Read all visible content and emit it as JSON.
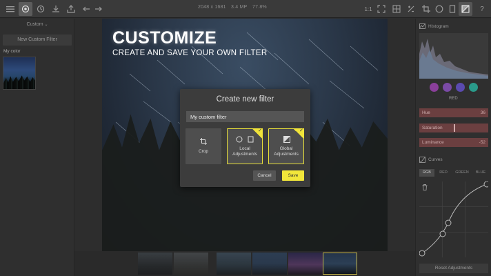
{
  "toolbar": {
    "image_dimensions": "2048 x 1681",
    "image_megapixels": "3.4 MP",
    "zoom": "77.8%",
    "zoom_ratio": "1:1",
    "icons": [
      "menu-icon",
      "filter-icon",
      "history-icon",
      "download-icon",
      "export-icon",
      "undo-icon",
      "redo-icon",
      "fit-icon",
      "compare-icon",
      "crop-icon",
      "vignette-icon",
      "frame-icon",
      "adjustments-icon",
      "help-icon"
    ]
  },
  "left_panel": {
    "header": "Custom",
    "new_button": "New Custom Filter",
    "my_filter_label": "My color"
  },
  "canvas": {
    "headline": "CUSTOMIZE",
    "subheadline": "CREATE AND SAVE YOUR OWN FILTER"
  },
  "modal": {
    "title": "Create new filter",
    "name_value": "My custom filter",
    "options": [
      {
        "label": "Crop",
        "selected": false
      },
      {
        "label": "Local Adjustments",
        "selected": true
      },
      {
        "label": "Global Adjustments",
        "selected": true
      }
    ],
    "cancel_label": "Cancel",
    "save_label": "Save"
  },
  "right_panel": {
    "histogram_label": "Histogram",
    "color_label": "RED",
    "colors": [
      "#8a3f9a",
      "#7a4aa6",
      "#5a4ab0",
      "#2a9a8a"
    ],
    "sliders": [
      {
        "label": "Hue",
        "value": "36"
      },
      {
        "label": "Saturation",
        "value": ""
      },
      {
        "label": "Luminance",
        "value": "-52"
      }
    ],
    "curves_label": "Curves",
    "curve_tabs": [
      "RGB",
      "RED",
      "GREEN",
      "BLUE"
    ],
    "reset_label": "Reset Adjustments"
  },
  "accent_color": "#f2e63a"
}
